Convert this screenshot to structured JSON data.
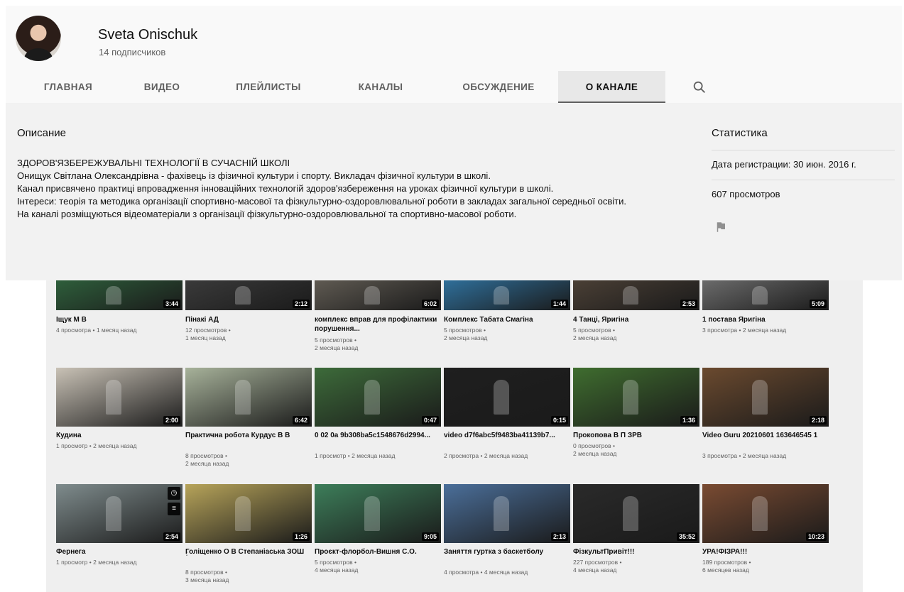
{
  "channel": {
    "name": "Sveta Onischuk",
    "subscribers": "14 подписчиков"
  },
  "tabs": [
    {
      "label": "ГЛАВНАЯ",
      "active": false
    },
    {
      "label": "ВИДЕО",
      "active": false
    },
    {
      "label": "ПЛЕЙЛИСТЫ",
      "active": false
    },
    {
      "label": "КАНАЛЫ",
      "active": false
    },
    {
      "label": "ОБСУЖДЕНИЕ",
      "active": false
    },
    {
      "label": "О КАНАЛЕ",
      "active": true
    }
  ],
  "icons": {
    "search": "search-icon",
    "flag": "flag-icon"
  },
  "about": {
    "description_title": "Описание",
    "description_lines": [
      "ЗДОРОВ'ЯЗБЕРЕЖУВАЛЬНІ ТЕХНОЛОГІЇ В СУЧАСНІЙ ШКОЛІ",
      "Онищук Світлана Олександрівна - фахівець із фізичної культури і спорту. Викладач фізичної культури в школі.",
      "Канал присвячено практиці впровадження інноваційних технологій здоров'язбереження на уроках фізичної культури в школі.",
      "Інтереси: теорія та методика організації спортивно-масової та фізкультурно-оздоровлювальної  роботи в закладах загальної середньої освіти.",
      "На каналі розміщуються відеоматеріали з організації фізкультурно-оздоровлювальної та спортивно-масової роботи."
    ],
    "stats_title": "Статистика",
    "registration": "Дата регистрации: 30 июн. 2016 г.",
    "views": "607 просмотров"
  },
  "videos": [
    {
      "title": "Іщук М В",
      "meta1": "4 просмотра • 1 месяц назад",
      "meta2": "",
      "duration": "3:44"
    },
    {
      "title": "Пінакі АД",
      "meta1": "12 просмотров •",
      "meta2": "1 месяц назад",
      "duration": "2:12"
    },
    {
      "title": "комплекс вправ для профілактики порушення...",
      "meta1": "5 просмотров •",
      "meta2": "2 месяца назад",
      "duration": "6:02"
    },
    {
      "title": "Комплекс Табата Смагіна",
      "meta1": "5 просмотров •",
      "meta2": "2 месяца назад",
      "duration": "1:44"
    },
    {
      "title": "4 Танці, Яригіна",
      "meta1": "5 просмотров •",
      "meta2": "2 месяца назад",
      "duration": "2:53"
    },
    {
      "title": "1 постава Яригіна",
      "meta1": "3 просмотра • 2 месяца назад",
      "meta2": "",
      "duration": "5:09"
    },
    {
      "title": "Кудина",
      "meta1": "1 просмотр • 2 месяца назад",
      "meta2": "",
      "duration": "2:00"
    },
    {
      "title": "Практична робота Курдус В В",
      "meta1": "8 просмотров •",
      "meta2": "2 месяца назад",
      "duration": "6:42"
    },
    {
      "title": "0 02 0a 9b308ba5c1548676d2994...",
      "meta1": "1 просмотр • 2 месяца назад",
      "meta2": "",
      "duration": "0:47"
    },
    {
      "title": "video d7f6abc5f9483ba41139b7...",
      "meta1": "2 просмотра • 2 месяца назад",
      "meta2": "",
      "duration": "0:15"
    },
    {
      "title": "Прокопова В П ЗРВ",
      "meta1": "0 просмотров •",
      "meta2": "2 месяца назад",
      "duration": "1:36"
    },
    {
      "title": "Video Guru 20210601 163646545 1",
      "meta1": "3 просмотра • 2 месяца назад",
      "meta2": "",
      "duration": "2:18"
    },
    {
      "title": "Фернега",
      "meta1": "1 просмотр • 2 месяца назад",
      "meta2": "",
      "duration": "2:54"
    },
    {
      "title": "Голіщенко О В Степаніаська ЗОШ",
      "meta1": "8 просмотров •",
      "meta2": "3 месяца назад",
      "duration": "1:26"
    },
    {
      "title": "Проєкт-флорбол-Вишня С.О.",
      "meta1": "5 просмотров •",
      "meta2": "4 месяца назад",
      "duration": "9:05"
    },
    {
      "title": "Заняття гуртка з баскетболу",
      "meta1": "4 просмотра • 4 месяца назад",
      "meta2": "",
      "duration": "2:13"
    },
    {
      "title": "ФізкультПривіт!!!",
      "meta1": "227 просмотров •",
      "meta2": "4 месяца назад",
      "duration": "35:52"
    },
    {
      "title": "УРА!ФІЗРА!!!",
      "meta1": "189 просмотров •",
      "meta2": "6 месяцев назад",
      "duration": "10:23"
    }
  ]
}
